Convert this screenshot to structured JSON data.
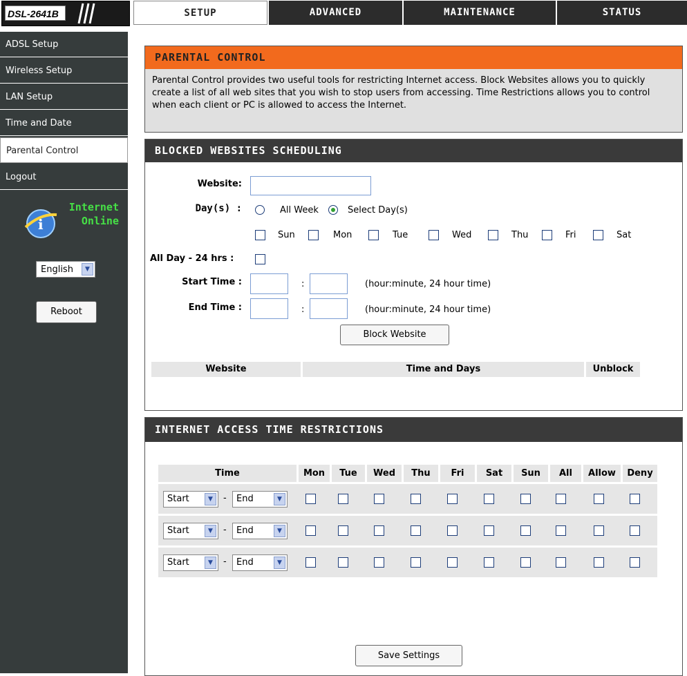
{
  "header": {
    "model": "DSL-2641B",
    "tabs": [
      {
        "label": "SETUP",
        "active": true
      },
      {
        "label": "ADVANCED",
        "active": false
      },
      {
        "label": "MAINTENANCE",
        "active": false
      },
      {
        "label": "STATUS",
        "active": false
      }
    ]
  },
  "sidebar": {
    "items": [
      {
        "label": "ADSL Setup"
      },
      {
        "label": "Wireless Setup"
      },
      {
        "label": "LAN Setup"
      },
      {
        "label": "Time and Date"
      },
      {
        "label": "Parental Control",
        "active": true
      },
      {
        "label": "Logout"
      }
    ],
    "status_line1": "Internet",
    "status_line2": "Online",
    "language": "English",
    "reboot_label": "Reboot"
  },
  "intro": {
    "title": "PARENTAL CONTROL",
    "text": "Parental Control provides two useful tools for restricting Internet access. Block Websites allows you to quickly create a list of all web sites that you wish to stop users from accessing. Time Restrictions allows you to control when each client or PC is allowed to access the Internet."
  },
  "blocked": {
    "title": "BLOCKED WEBSITES SCHEDULING",
    "website_label": "Website:",
    "website_value": "",
    "days_label": "Day(s) :",
    "all_week": "All Week",
    "select_days": "Select Day(s)",
    "days": [
      "Sun",
      "Mon",
      "Tue",
      "Wed",
      "Thu",
      "Fri",
      "Sat"
    ],
    "allday_label": "All Day - 24 hrs :",
    "start_label": "Start Time :",
    "end_label": "End Time :",
    "colon": ":",
    "time_hint": "(hour:minute, 24 hour time)",
    "block_button": "Block Website",
    "table_headers": [
      "Website",
      "Time and Days",
      "Unblock"
    ]
  },
  "restrictions": {
    "title": "INTERNET ACCESS TIME RESTRICTIONS",
    "headers": [
      "Time",
      "Mon",
      "Tue",
      "Wed",
      "Thu",
      "Fri",
      "Sat",
      "Sun",
      "All",
      "Allow",
      "Deny"
    ],
    "rows": [
      {
        "start": "Start",
        "end": "End"
      },
      {
        "start": "Start",
        "end": "End"
      },
      {
        "start": "Start",
        "end": "End"
      }
    ],
    "dash": "-",
    "save_button": "Save Settings"
  },
  "colors": {
    "orange": "#f26a1d",
    "dark": "#3a3a3a",
    "sidebar": "#363c3c",
    "online_green": "#46e046"
  }
}
